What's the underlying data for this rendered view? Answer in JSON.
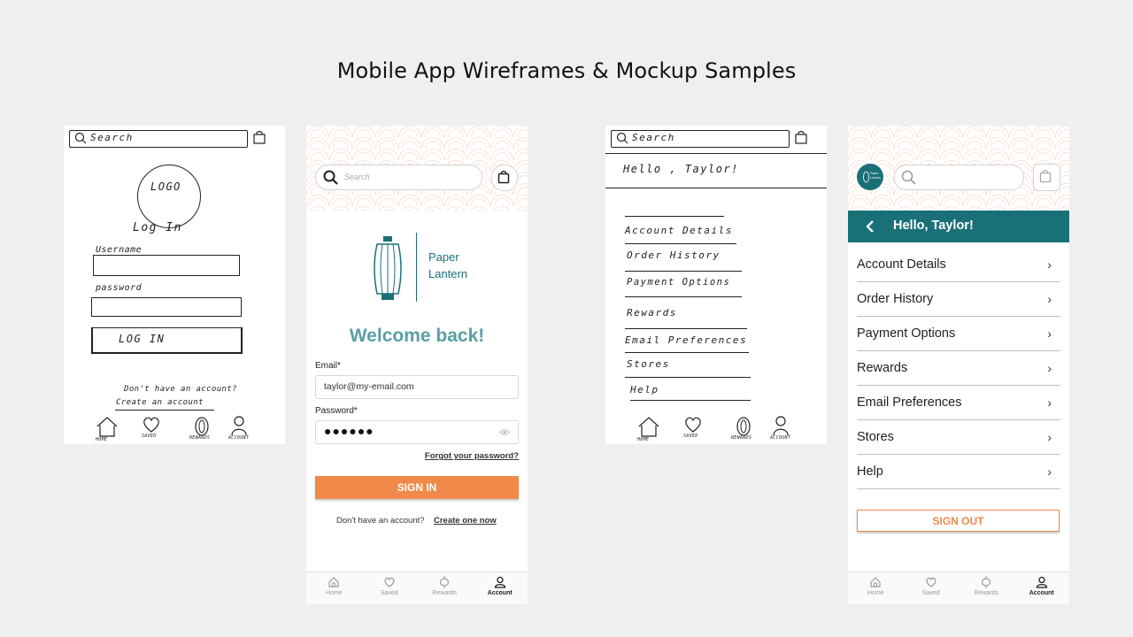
{
  "page": {
    "title": "Mobile App Wireframes & Mockup Samples"
  },
  "wireframe_login": {
    "search": "Search",
    "logo": "LOGO",
    "heading": "Log  In",
    "username_label": "Username",
    "password_label": "password",
    "login_button": "LOG  IN",
    "no_account": "Don't  have  an  account?",
    "create_link": "Create  an  account",
    "nav": [
      "HOME",
      "SAVED",
      "REWARDS",
      "ACCOUNT"
    ]
  },
  "mockup_login": {
    "search_placeholder": "Search",
    "brand_line1": "Paper",
    "brand_line2": "Lantern",
    "welcome": "Welcome back!",
    "email_label": "Email*",
    "email_value": "taylor@my-email.com",
    "password_label": "Password*",
    "password_value": "●●●●●●",
    "forgot": "Forgot your password?",
    "sign_in": "SIGN IN",
    "no_account": "Don't have an account?",
    "create_link": "Create one now",
    "nav": [
      "Home",
      "Saved",
      "Rewards",
      "Account"
    ],
    "active_nav": "Account",
    "accent": "#f0894a",
    "teal": "#1a7077"
  },
  "wireframe_account": {
    "search": "Search",
    "greeting": "Hello , Taylor!",
    "menu": [
      "Account  Details",
      "Order  History",
      "Payment  Options",
      "Rewards",
      "Email  Preferences",
      "Stores",
      "Help"
    ],
    "nav": [
      "HOME",
      "SAVED",
      "REWARDS",
      "ACCOUNT"
    ]
  },
  "mockup_account": {
    "logo_text": "Paper Lantern",
    "greeting": "Hello, Taylor!",
    "menu": [
      "Account Details",
      "Order History",
      "Payment Options",
      "Rewards",
      "Email Preferences",
      "Stores",
      "Help"
    ],
    "sign_out": "SIGN OUT",
    "nav": [
      "Home",
      "Saved",
      "Rewards",
      "Account"
    ],
    "active_nav": "Account"
  }
}
